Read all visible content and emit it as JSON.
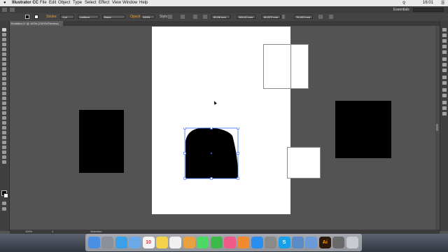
{
  "menubar": {
    "app_name": "Illustrator CC",
    "items": [
      "File",
      "Edit",
      "Object",
      "Type",
      "Select",
      "Effect",
      "View",
      "Window",
      "Help"
    ],
    "clock": "16:01"
  },
  "appbar": {
    "workspace": "Essentials"
  },
  "controlbar": {
    "stroke_label": "Stroke:",
    "stroke_value": "1 pt",
    "uniform_label": "Uniform",
    "basic_label": "Basic",
    "opacity_label": "Opacity:",
    "opacity_value": "100%",
    "style_label": "Style:",
    "x_value": "60,96 mm",
    "y_value": "164,61 mm",
    "w_value": "60,572 mm",
    "h_value": "76,403 mm"
  },
  "document": {
    "tab_title": "Untitled-1* @ 100% (CMYK/Preview)"
  },
  "statusbar": {
    "zoom": "100%",
    "page": "1",
    "tool": "Selection"
  },
  "dock": {
    "apps": [
      {
        "name": "finder",
        "color": "#4a90e2"
      },
      {
        "name": "launchpad",
        "color": "#8a8f98"
      },
      {
        "name": "safari",
        "color": "#3aa0e8"
      },
      {
        "name": "mail",
        "color": "#6aa8e8"
      },
      {
        "name": "calendar",
        "color": "#f4f4f4",
        "label": "10"
      },
      {
        "name": "notes",
        "color": "#f4d24a"
      },
      {
        "name": "reminders",
        "color": "#f0f0f0"
      },
      {
        "name": "photos",
        "color": "#e8a040"
      },
      {
        "name": "messages",
        "color": "#4cd964"
      },
      {
        "name": "facetime",
        "color": "#3cb94a"
      },
      {
        "name": "itunes",
        "color": "#f05a8a"
      },
      {
        "name": "ibooks",
        "color": "#f08a30"
      },
      {
        "name": "app-store",
        "color": "#2a8ef0"
      },
      {
        "name": "system-preferences",
        "color": "#8a8a8a"
      },
      {
        "name": "skype",
        "color": "#1aa0e8",
        "label": "S"
      },
      {
        "name": "image-capture",
        "color": "#5a8ac8"
      },
      {
        "name": "preview",
        "color": "#6a9ad8"
      },
      {
        "name": "illustrator",
        "color": "#2b1a0a",
        "label": "Ai"
      },
      {
        "name": "screenshot",
        "color": "#6a6a6a"
      },
      {
        "name": "trash",
        "color": "#c8ccd0"
      }
    ]
  }
}
